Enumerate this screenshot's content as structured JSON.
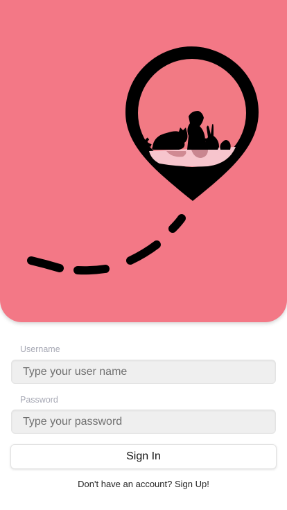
{
  "colors": {
    "hero_background": "#f37886",
    "pin_fill": "#000000",
    "pin_inner": "#f27a84",
    "accent_text": "#a7a9b5"
  },
  "hero": {
    "illustration": "map-pin-pets-icon",
    "path": "dashed-route"
  },
  "form": {
    "username_label": "Username",
    "username_placeholder": "Type your user name",
    "password_label": "Password",
    "password_placeholder": "Type your password",
    "sign_in_label": "Sign In",
    "signup_prompt": "Don't have an account? ",
    "signup_link": "Sign Up!"
  }
}
